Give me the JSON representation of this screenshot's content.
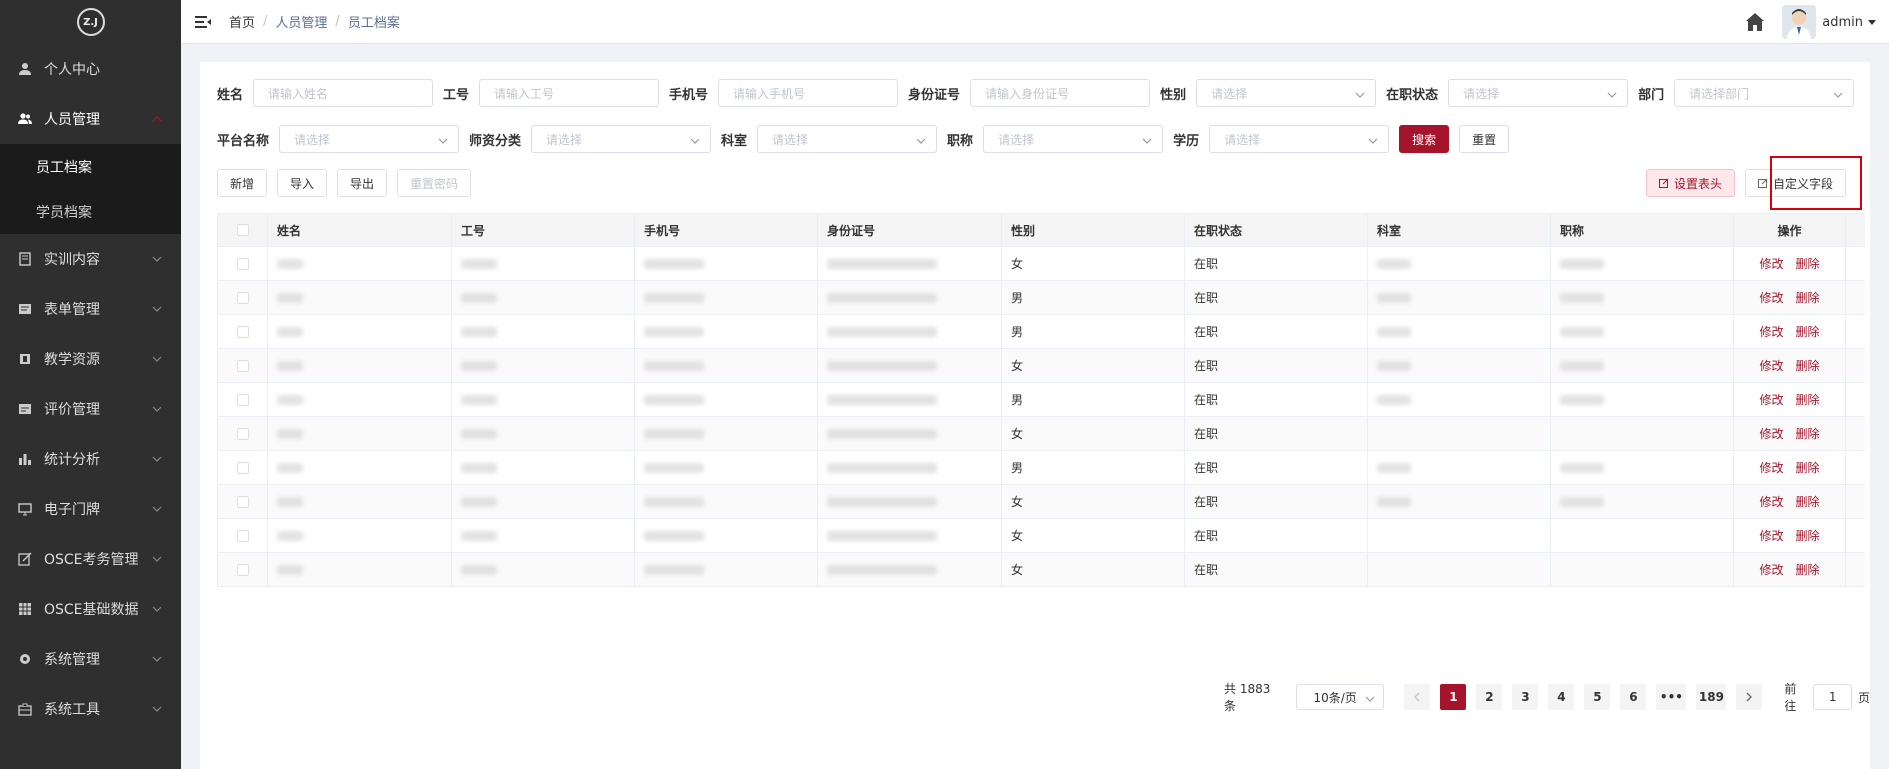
{
  "sidebar": {
    "logo": "Z.J",
    "items": [
      {
        "label": "个人中心",
        "icon": "user-icon"
      },
      {
        "label": "人员管理",
        "icon": "users-icon",
        "expanded": true
      },
      {
        "label": "实训内容",
        "icon": "book-icon"
      },
      {
        "label": "表单管理",
        "icon": "form-icon"
      },
      {
        "label": "教学资源",
        "icon": "resource-icon"
      },
      {
        "label": "评价管理",
        "icon": "evaluation-icon"
      },
      {
        "label": "统计分析",
        "icon": "bar-chart-icon"
      },
      {
        "label": "电子门牌",
        "icon": "monitor-icon"
      },
      {
        "label": "OSCE考务管理",
        "icon": "edit-icon"
      },
      {
        "label": "OSCE基础数据",
        "icon": "grid-icon"
      },
      {
        "label": "系统管理",
        "icon": "gear-icon"
      },
      {
        "label": "系统工具",
        "icon": "toolbox-icon"
      }
    ],
    "submenu": [
      {
        "label": "员工档案",
        "active": true
      },
      {
        "label": "学员档案",
        "active": false
      }
    ]
  },
  "topbar": {
    "breadcrumb": [
      "首页",
      "人员管理",
      "员工档案"
    ],
    "username": "admin"
  },
  "filters": {
    "row1": [
      {
        "label": "姓名",
        "placeholder": "请输入姓名"
      },
      {
        "label": "工号",
        "placeholder": "请输入工号"
      },
      {
        "label": "手机号",
        "placeholder": "请输入手机号"
      },
      {
        "label": "身份证号",
        "placeholder": "请输入身份证号"
      },
      {
        "label": "性别",
        "placeholder": "请选择"
      },
      {
        "label": "在职状态",
        "placeholder": "请选择"
      },
      {
        "label": "部门",
        "placeholder": "请选择部门"
      }
    ],
    "row2": [
      {
        "label": "平台名称",
        "placeholder": "请选择"
      },
      {
        "label": "师资分类",
        "placeholder": "请选择"
      },
      {
        "label": "科室",
        "placeholder": "请选择"
      },
      {
        "label": "职称",
        "placeholder": "请选择"
      },
      {
        "label": "学历",
        "placeholder": "请选择"
      }
    ],
    "search_label": "搜索",
    "reset_label": "重置"
  },
  "toolbar": {
    "add": "新增",
    "import": "导入",
    "export": "导出",
    "reset_password": "重置密码",
    "set_header": "设置表头",
    "custom_fields": "自定义字段"
  },
  "table": {
    "columns": [
      "姓名",
      "工号",
      "手机号",
      "身份证号",
      "性别",
      "在职状态",
      "科室",
      "职称",
      "操作"
    ],
    "rows": [
      {
        "gender": "女",
        "status": "在职",
        "dept": true,
        "title": true
      },
      {
        "gender": "男",
        "status": "在职",
        "dept": true,
        "title": true
      },
      {
        "gender": "男",
        "status": "在职",
        "dept": true,
        "title": true
      },
      {
        "gender": "女",
        "status": "在职",
        "dept": true,
        "title": true
      },
      {
        "gender": "男",
        "status": "在职",
        "dept": true,
        "title": true
      },
      {
        "gender": "女",
        "status": "在职",
        "dept": false,
        "title": false
      },
      {
        "gender": "男",
        "status": "在职",
        "dept": true,
        "title": true
      },
      {
        "gender": "女",
        "status": "在职",
        "dept": true,
        "title": true
      },
      {
        "gender": "女",
        "status": "在职",
        "dept": false,
        "title": false
      },
      {
        "gender": "女",
        "status": "在职",
        "dept": false,
        "title": false
      }
    ],
    "edit_label": "修改",
    "delete_label": "删除"
  },
  "pagination": {
    "total": "共 1883 条",
    "page_size": "10条/页",
    "pages": [
      "1",
      "2",
      "3",
      "4",
      "5",
      "6",
      "•••",
      "189"
    ],
    "current": "1",
    "goto_label": "前往",
    "goto_value": "1",
    "page_suffix": "页"
  },
  "colors": {
    "accent": "#a5142a",
    "sidebar_bg": "#2f2f2f",
    "highlight": "#d9000d"
  }
}
